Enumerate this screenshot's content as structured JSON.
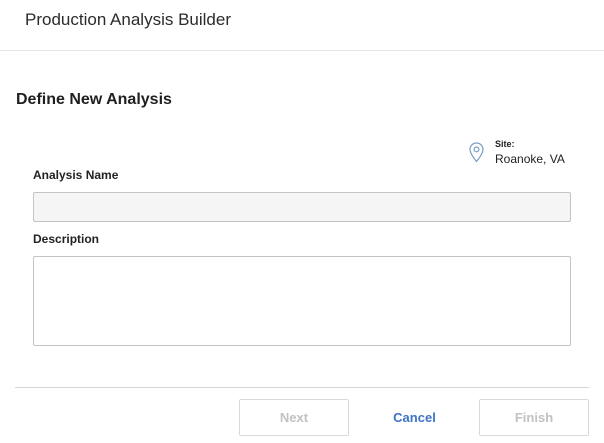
{
  "dialog": {
    "title": "Production Analysis Builder"
  },
  "form": {
    "section_title": "Define New Analysis",
    "site": {
      "label": "Site:",
      "value": "Roanoke, VA",
      "icon": "location-pin-icon"
    },
    "analysis_name": {
      "label": "Analysis Name",
      "value": "",
      "placeholder": ""
    },
    "description": {
      "label": "Description",
      "value": "",
      "placeholder": ""
    }
  },
  "footer": {
    "next_label": "Next",
    "cancel_label": "Cancel",
    "finish_label": "Finish"
  },
  "colors": {
    "accent": "#3d73c7",
    "disabled_text": "#c2c2c2",
    "icon": "#7a9cc6"
  }
}
